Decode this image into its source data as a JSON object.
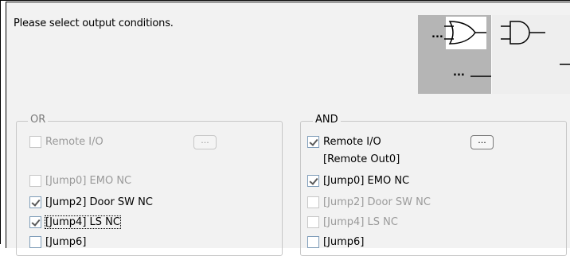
{
  "prompt": "Please select output conditions.",
  "or_group": {
    "legend": "OR",
    "remote_io": {
      "label": "Remote I/O",
      "checked": false,
      "enabled": false
    },
    "browse_button": "...",
    "items": [
      {
        "label": "[Jump0] EMO NC",
        "checked": false,
        "enabled": false
      },
      {
        "label": "[Jump2] Door SW NC",
        "checked": true,
        "enabled": true
      },
      {
        "label": "[Jump4] LS NC",
        "checked": true,
        "enabled": true
      },
      {
        "label": "[Jump6]",
        "checked": false,
        "enabled": true
      }
    ]
  },
  "and_group": {
    "legend": "AND",
    "remote_io": {
      "label": "Remote I/O",
      "checked": true,
      "enabled": true
    },
    "browse_button": "...",
    "remote_out": "[Remote Out0]",
    "items": [
      {
        "label": "[Jump0] EMO NC",
        "checked": true,
        "enabled": true
      },
      {
        "label": "[Jump2] Door SW NC",
        "checked": false,
        "enabled": false
      },
      {
        "label": "[Jump4] LS NC",
        "checked": false,
        "enabled": false
      },
      {
        "label": "[Jump6]",
        "checked": false,
        "enabled": true
      }
    ]
  },
  "diagram": {
    "or_gate": "or-gate-icon",
    "and_gate": "and-gate-icon",
    "ellipsis": "..."
  }
}
